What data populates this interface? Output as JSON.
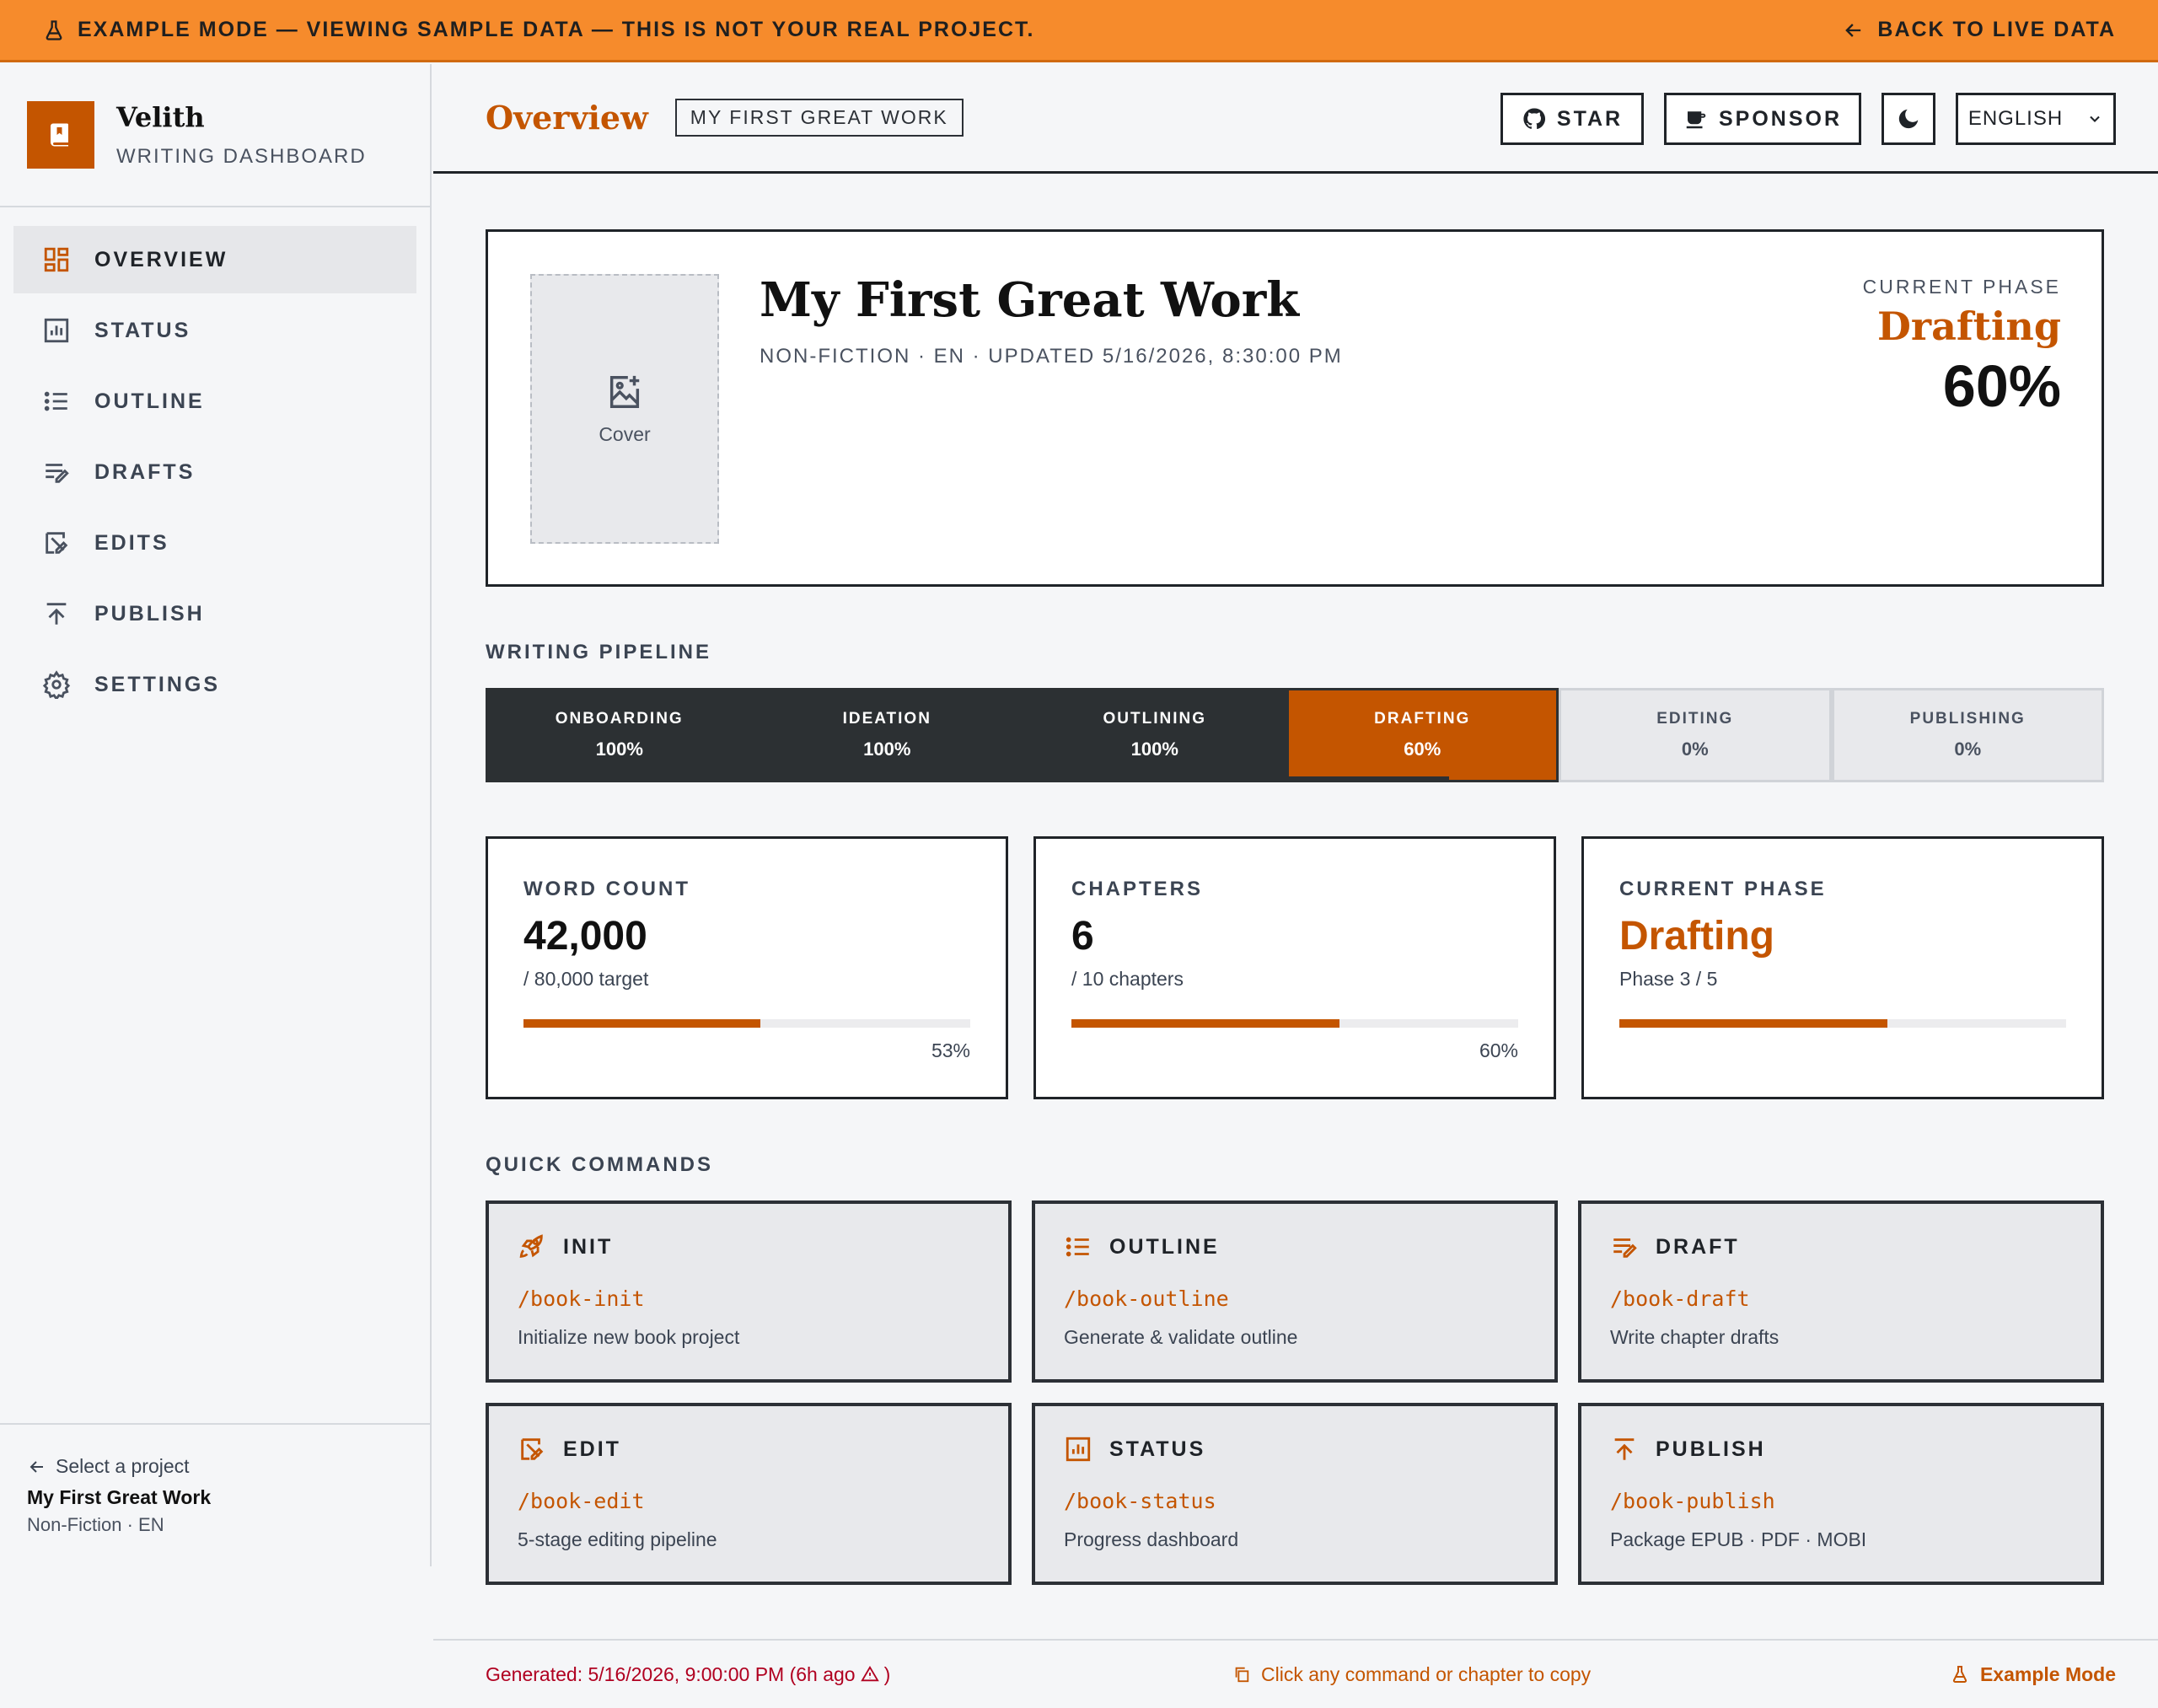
{
  "banner": {
    "message": "EXAMPLE MODE — VIEWING SAMPLE DATA — THIS IS NOT YOUR REAL PROJECT.",
    "back_label": "BACK TO LIVE DATA",
    "icon_left": "flask-icon",
    "icon_right": "arrow-left-icon"
  },
  "brand": {
    "name": "Velith",
    "subtitle": "WRITING DASHBOARD",
    "icon": "book-icon"
  },
  "sidebar": {
    "items": [
      {
        "label": "OVERVIEW",
        "icon": "dashboard-icon",
        "active": true
      },
      {
        "label": "STATUS",
        "icon": "chart-icon",
        "active": false
      },
      {
        "label": "OUTLINE",
        "icon": "list-icon",
        "active": false
      },
      {
        "label": "DRAFTS",
        "icon": "draft-pen-icon",
        "active": false
      },
      {
        "label": "EDITS",
        "icon": "edit-icon",
        "active": false
      },
      {
        "label": "PUBLISH",
        "icon": "upload-icon",
        "active": false
      },
      {
        "label": "SETTINGS",
        "icon": "gear-icon",
        "active": false
      }
    ],
    "footer": {
      "back_label": "Select a project",
      "project_title": "My First Great Work",
      "project_meta": "Non-Fiction · EN"
    }
  },
  "header": {
    "title": "Overview",
    "badge": "MY FIRST GREAT WORK",
    "star_label": "STAR",
    "sponsor_label": "SPONSOR",
    "language": "ENGLISH"
  },
  "hero": {
    "cover_label": "Cover",
    "title": "My First Great Work",
    "meta": "NON-FICTION · EN · UPDATED 5/16/2026, 8:30:00 PM",
    "phase_label": "CURRENT PHASE",
    "phase": "Drafting",
    "percent": "60%"
  },
  "pipeline": {
    "label": "WRITING PIPELINE",
    "stages": [
      {
        "name": "ONBOARDING",
        "pct": "100%",
        "state": "done",
        "progress": 1.0
      },
      {
        "name": "IDEATION",
        "pct": "100%",
        "state": "done",
        "progress": 1.0
      },
      {
        "name": "OUTLINING",
        "pct": "100%",
        "state": "done",
        "progress": 1.0
      },
      {
        "name": "DRAFTING",
        "pct": "60%",
        "state": "current",
        "progress": 0.6
      },
      {
        "name": "EDITING",
        "pct": "0%",
        "state": "todo",
        "progress": 0
      },
      {
        "name": "PUBLISHING",
        "pct": "0%",
        "state": "todo",
        "progress": 0
      }
    ]
  },
  "stats": [
    {
      "label": "WORD COUNT",
      "value": "42,000",
      "sub": "/ 80,000 target",
      "pct": "53%",
      "progress": 0.53,
      "accent": false
    },
    {
      "label": "CHAPTERS",
      "value": "6",
      "sub": "/ 10 chapters",
      "pct": "60%",
      "progress": 0.6,
      "accent": false
    },
    {
      "label": "CURRENT PHASE",
      "value": "Drafting",
      "sub": "Phase 3 / 5",
      "pct": "",
      "progress": 0.6,
      "accent": true
    }
  ],
  "commands": {
    "label": "QUICK COMMANDS",
    "items": [
      {
        "title": "INIT",
        "command": "/book-init",
        "desc": "Initialize new book project",
        "icon": "rocket-icon"
      },
      {
        "title": "OUTLINE",
        "command": "/book-outline",
        "desc": "Generate & validate outline",
        "icon": "list-icon"
      },
      {
        "title": "DRAFT",
        "command": "/book-draft",
        "desc": "Write chapter drafts",
        "icon": "draft-pen-icon"
      },
      {
        "title": "EDIT",
        "command": "/book-edit",
        "desc": "5-stage editing pipeline",
        "icon": "edit-icon"
      },
      {
        "title": "STATUS",
        "command": "/book-status",
        "desc": "Progress dashboard",
        "icon": "chart-icon"
      },
      {
        "title": "PUBLISH",
        "command": "/book-publish",
        "desc": "Package EPUB · PDF · MOBI",
        "icon": "upload-icon"
      }
    ]
  },
  "footer": {
    "generated": "Generated: 5/16/2026, 9:00:00 PM (6h ago",
    "generated_end": ")",
    "hint": "Click any command or chapter to copy",
    "mode": "Example Mode"
  },
  "colors": {
    "accent": "#c45500",
    "banner": "#f68b2c",
    "dark": "#2c3033",
    "warning": "#b00020"
  }
}
